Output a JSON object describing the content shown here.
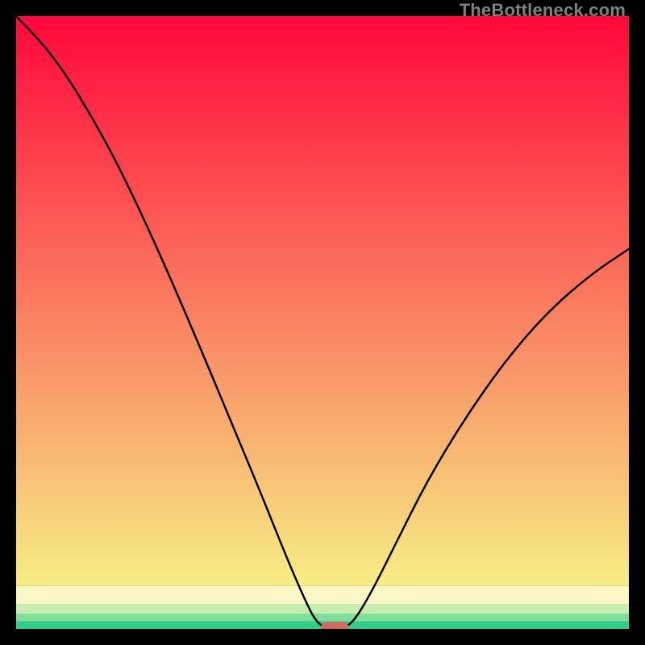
{
  "watermark": "TheBottleneck.com",
  "chart_data": {
    "type": "line",
    "title": "",
    "xlabel": "",
    "ylabel": "",
    "xlim": [
      0,
      100
    ],
    "ylim": [
      0,
      100
    ],
    "series": [
      {
        "name": "curve",
        "values": [
          {
            "x": 0,
            "y": 100
          },
          {
            "x": 3,
            "y": 97
          },
          {
            "x": 7.5,
            "y": 91.5
          },
          {
            "x": 13,
            "y": 82.5
          },
          {
            "x": 18,
            "y": 73
          },
          {
            "x": 24,
            "y": 60
          },
          {
            "x": 30,
            "y": 46
          },
          {
            "x": 35,
            "y": 34
          },
          {
            "x": 40,
            "y": 22
          },
          {
            "x": 44,
            "y": 12
          },
          {
            "x": 47,
            "y": 5
          },
          {
            "x": 49,
            "y": 1
          },
          {
            "x": 51,
            "y": 0
          },
          {
            "x": 53,
            "y": 0
          },
          {
            "x": 55,
            "y": 1
          },
          {
            "x": 58,
            "y": 6
          },
          {
            "x": 62,
            "y": 14
          },
          {
            "x": 67,
            "y": 24
          },
          {
            "x": 73,
            "y": 34
          },
          {
            "x": 80,
            "y": 44
          },
          {
            "x": 87,
            "y": 52
          },
          {
            "x": 94,
            "y": 58
          },
          {
            "x": 100,
            "y": 62
          }
        ]
      }
    ],
    "bands": [
      {
        "y0": 7,
        "y1": 100,
        "type": "gradient",
        "from": "#f6ee84",
        "to": "#ff073a"
      },
      {
        "y0": 4,
        "y1": 7,
        "color": "#f9f7c6"
      },
      {
        "y0": 2.5,
        "y1": 4,
        "color": "#c7edb1"
      },
      {
        "y0": 1.2,
        "y1": 2.5,
        "color": "#7fdf9c"
      },
      {
        "y0": 0,
        "y1": 1.2,
        "color": "#2ecf87"
      }
    ],
    "marker": {
      "x": 52,
      "y": 0,
      "color": "#d36a62",
      "rx": 2
    }
  }
}
